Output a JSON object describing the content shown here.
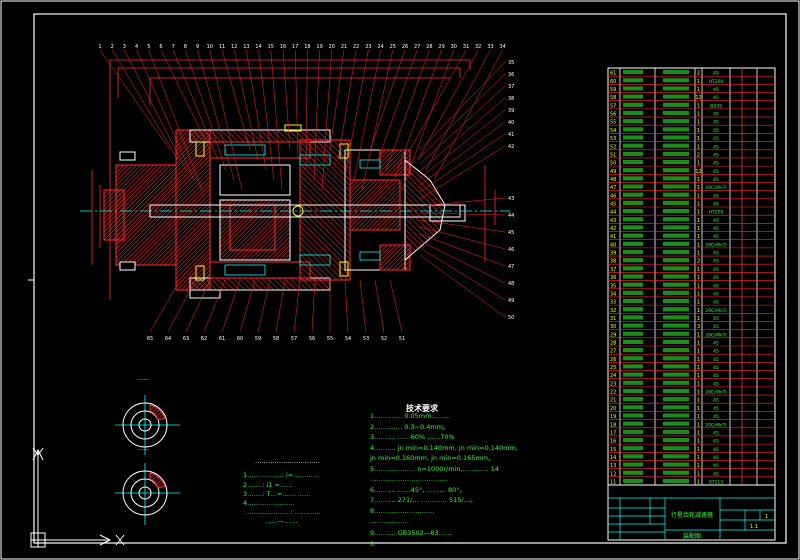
{
  "colors": {
    "background": "#000000",
    "frame": "#ffffff",
    "section": "#ff2a2a",
    "centerline": "#00ffff",
    "text": "#33ff33",
    "annotation": "#ffff00"
  },
  "callouts_top": [
    "1",
    "2",
    "3",
    "4",
    "5",
    "6",
    "7",
    "8",
    "9",
    "10",
    "11",
    "12",
    "13",
    "14",
    "15",
    "16",
    "17",
    "18",
    "19",
    "20",
    "21",
    "22",
    "23",
    "24",
    "25",
    "26",
    "27",
    "28",
    "29",
    "30",
    "31",
    "32",
    "33",
    "34"
  ],
  "callouts_right": [
    "35",
    "36",
    "37",
    "38",
    "39",
    "40",
    "41",
    "42",
    "43",
    "44",
    "45",
    "46",
    "47",
    "48",
    "49",
    "50"
  ],
  "callouts_bottom": [
    "65",
    "64",
    "63",
    "62",
    "61",
    "60",
    "59",
    "58",
    "57",
    "56",
    "55",
    "54",
    "53",
    "52",
    "51"
  ],
  "tech_requirements": {
    "title": "技术要求",
    "lines": [
      "1.………… 0.05mm………",
      "2.………… 0.3~0.4mm。",
      "3.……… ……60% ……70%",
      "4.……… jn      min=0.140mm, jn min=0.140mm,",
      "          jn min=0.160mm, jn min=0.165mm。",
      "5.……………… n=1000r/min,………… 14",
      "  ………………………………",
      "6.……… ……45°, ……… 80°。",
      "7.……… 271/… ………… 515/…。",
      "8.………………………",
      "  ………………",
      "9.……… GB3502—83……",
      "0."
    ]
  },
  "spec_note": {
    "title": "…………………………",
    "lines": [
      "1.……………: i=…………",
      "2.……: i1 =……",
      "3.……: T…=…… ……",
      "4.…………………",
      "…………………: …………",
      "……—……"
    ]
  },
  "views": {
    "view_a": "……",
    "view_b": "……"
  },
  "parts_table": {
    "rows": [
      {
        "no": "61",
        "qty": "2",
        "mat": "45"
      },
      {
        "no": "60",
        "qty": "1",
        "mat": "HT200"
      },
      {
        "no": "59",
        "qty": "1",
        "mat": "45"
      },
      {
        "no": "58",
        "qty": "12",
        "mat": "45"
      },
      {
        "no": "57",
        "qty": "1",
        "mat": "Q235"
      },
      {
        "no": "56",
        "qty": "1",
        "mat": "45"
      },
      {
        "no": "55",
        "qty": "1",
        "mat": "45"
      },
      {
        "no": "54",
        "qty": "1",
        "mat": "45"
      },
      {
        "no": "53",
        "qty": "1",
        "mat": "45"
      },
      {
        "no": "52",
        "qty": "1",
        "mat": "45"
      },
      {
        "no": "51",
        "qty": "2",
        "mat": "45"
      },
      {
        "no": "50",
        "qty": "1",
        "mat": "45"
      },
      {
        "no": "49",
        "qty": "12",
        "mat": "45"
      },
      {
        "no": "48",
        "qty": "1",
        "mat": "45"
      },
      {
        "no": "47",
        "qty": "1",
        "mat": "20CrMnTi"
      },
      {
        "no": "46",
        "qty": "1",
        "mat": "45"
      },
      {
        "no": "45",
        "qty": "1",
        "mat": "45"
      },
      {
        "no": "44",
        "qty": "1",
        "mat": "HT200"
      },
      {
        "no": "43",
        "qty": "1",
        "mat": "45"
      },
      {
        "no": "42",
        "qty": "1",
        "mat": "45"
      },
      {
        "no": "41",
        "qty": "1",
        "mat": "45"
      },
      {
        "no": "40",
        "qty": "1",
        "mat": "20CrMnTi"
      },
      {
        "no": "39",
        "qty": "1",
        "mat": "45"
      },
      {
        "no": "38",
        "qty": "2",
        "mat": "45"
      },
      {
        "no": "37",
        "qty": "1",
        "mat": "45"
      },
      {
        "no": "36",
        "qty": "1",
        "mat": "45"
      },
      {
        "no": "35",
        "qty": "1",
        "mat": "45"
      },
      {
        "no": "34",
        "qty": "1",
        "mat": "45"
      },
      {
        "no": "33",
        "qty": "1",
        "mat": "45"
      },
      {
        "no": "32",
        "qty": "1",
        "mat": "20CrMnTi"
      },
      {
        "no": "31",
        "qty": "1",
        "mat": "45"
      },
      {
        "no": "30",
        "qty": "3",
        "mat": "45"
      },
      {
        "no": "29",
        "qty": "1",
        "mat": "20CrMnTi"
      },
      {
        "no": "28",
        "qty": "1",
        "mat": "45"
      },
      {
        "no": "27",
        "qty": "1",
        "mat": "45"
      },
      {
        "no": "26",
        "qty": "1",
        "mat": "45"
      },
      {
        "no": "25",
        "qty": "1",
        "mat": "45"
      },
      {
        "no": "24",
        "qty": "1",
        "mat": "45"
      },
      {
        "no": "23",
        "qty": "1",
        "mat": "45"
      },
      {
        "no": "22",
        "qty": "1",
        "mat": "20CrMnTi"
      },
      {
        "no": "21",
        "qty": "1",
        "mat": "45"
      },
      {
        "no": "20",
        "qty": "1",
        "mat": "45"
      },
      {
        "no": "19",
        "qty": "1",
        "mat": "45"
      },
      {
        "no": "18",
        "qty": "1",
        "mat": "20CrMnTi"
      },
      {
        "no": "17",
        "qty": "1",
        "mat": "45"
      },
      {
        "no": "16",
        "qty": "1",
        "mat": "45"
      },
      {
        "no": "15",
        "qty": "1",
        "mat": "45"
      },
      {
        "no": "14",
        "qty": "1",
        "mat": "45"
      },
      {
        "no": "13",
        "qty": "1",
        "mat": "45"
      },
      {
        "no": "12",
        "qty": "1",
        "mat": "45"
      },
      {
        "no": "11",
        "qty": "1",
        "mat": "07113"
      }
    ]
  },
  "title_block": {
    "drawing_name": "行星齿轮减速器",
    "subtitle": "装配图",
    "scale": "1:1",
    "sheet": "1"
  }
}
